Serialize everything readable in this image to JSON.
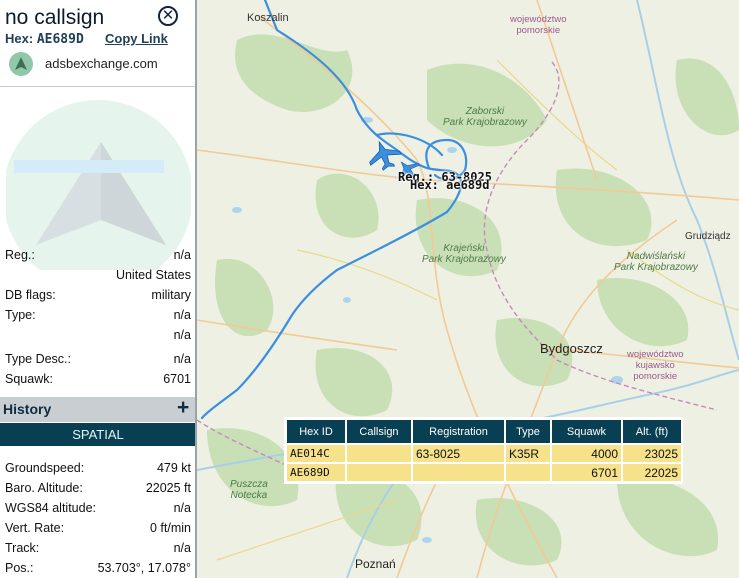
{
  "sidebar": {
    "callsign": "no callsign",
    "hex_label": "Hex:",
    "hex_value": "AE689D",
    "copy_link": "Copy Link",
    "source": "adsbexchange.com",
    "info_rows": [
      {
        "label": "Reg.:",
        "value": "n/a"
      },
      {
        "label": "",
        "value": "United States"
      },
      {
        "label": "DB flags:",
        "value": "military"
      },
      {
        "label": "Type:",
        "value": "n/a"
      },
      {
        "label": "",
        "value": "n/a"
      },
      {
        "label": "Type Desc.:",
        "value": "n/a"
      },
      {
        "label": "Squawk:",
        "value": "6701"
      }
    ],
    "history_title": "History",
    "history_plus": "+",
    "spatial_title": "SPATIAL",
    "spatial_rows": [
      {
        "label": "Groundspeed:",
        "value": "479 kt"
      },
      {
        "label": "Baro. Altitude:",
        "value": "22025 ft"
      },
      {
        "label": "WGS84 altitude:",
        "value": "n/a"
      },
      {
        "label": "Vert. Rate:",
        "value": "0 ft/min"
      },
      {
        "label": "Track:",
        "value": "n/a"
      },
      {
        "label": "Pos.:",
        "value": "53.703°, 17.078°"
      }
    ]
  },
  "map": {
    "labels": {
      "koszalin": "Koszalin",
      "woj_pomorskie": "województwo\npomorskie",
      "zaborski": "Zaborski\nPark Krajobrazowy",
      "krajenski": "Krajeński\nPark Krajobrazowy",
      "nadwislanski": "Nadwiślański\nPark Krajobrazowy",
      "grudziadz": "Grudziądz",
      "bydgoszcz": "Bydgoszcz",
      "woj_kujawsko": "województwo\nkujawsko\npomorskie",
      "puszcza": "Puszcza\nNotecka",
      "poznan": "Poznań"
    },
    "plane_reg": "Reg.: 63-8025",
    "plane_hex": "Hex: ae689d",
    "colors": {
      "track": "#3a8fe0",
      "plane": "#3a8fe0",
      "land": "#eef0e4",
      "forest": "#c8dfb6"
    }
  },
  "table": {
    "headers": [
      "Hex ID",
      "Callsign",
      "Registration",
      "Type",
      "Squawk",
      "Alt. (ft)"
    ],
    "rows": [
      [
        "AE014C",
        "",
        "63-8025",
        "K35R",
        "4000",
        "23025"
      ],
      [
        "AE689D",
        "",
        "",
        "",
        "6701",
        "22025"
      ]
    ]
  }
}
